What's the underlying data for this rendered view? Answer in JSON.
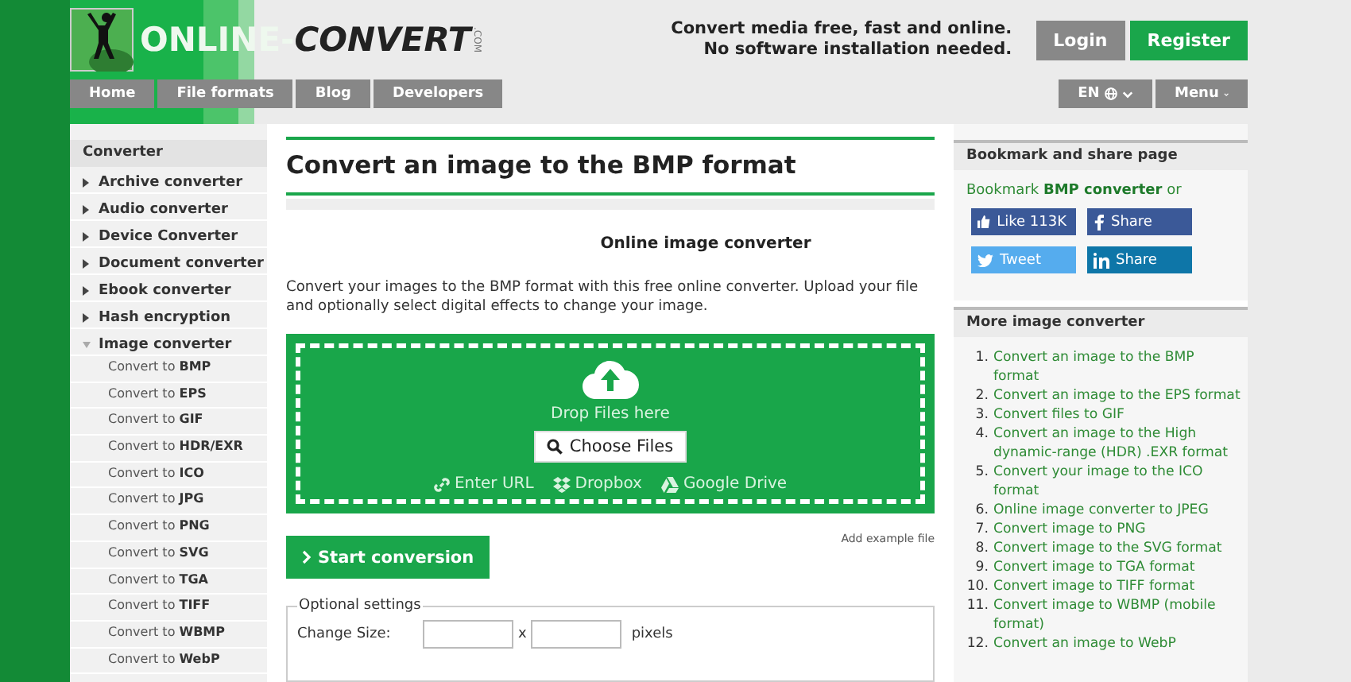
{
  "logo": {
    "part1": "ONLINE-",
    "part2": "CONVERT",
    "part3": ".COM"
  },
  "tagline": [
    "Convert media free, fast and online.",
    "No software installation needed."
  ],
  "account_buttons": [
    {
      "label": "Login",
      "kind": "secondary"
    },
    {
      "label": "Register",
      "kind": "primary"
    }
  ],
  "nav": [
    {
      "label": "Home"
    },
    {
      "label": "File formats"
    },
    {
      "label": "Blog"
    },
    {
      "label": "Developers"
    }
  ],
  "nav_right": [
    {
      "label": "EN",
      "kind": "language"
    },
    {
      "label": "Menu",
      "kind": "menu"
    }
  ],
  "sidebar": {
    "title": "Converter",
    "items": [
      {
        "label": "Archive converter",
        "expanded": false
      },
      {
        "label": "Audio converter",
        "expanded": false
      },
      {
        "label": "Device Converter",
        "expanded": false
      },
      {
        "label": "Document converter",
        "expanded": false
      },
      {
        "label": "Ebook converter",
        "expanded": false
      },
      {
        "label": "Hash encryption",
        "expanded": false
      },
      {
        "label": "Image converter",
        "expanded": true,
        "children": [
          {
            "label": "Convert to **BMP**"
          },
          {
            "label": "Convert to **EPS**"
          },
          {
            "label": "Convert to **GIF**"
          },
          {
            "label": "Convert to **HDR/EXR**"
          },
          {
            "label": "Convert to **ICO**"
          },
          {
            "label": "Convert to **JPG**"
          },
          {
            "label": "Convert to **PNG**"
          },
          {
            "label": "Convert to **SVG**"
          },
          {
            "label": "Convert to **TGA**"
          },
          {
            "label": "Convert to **TIFF**"
          },
          {
            "label": "Convert to **WBMP**"
          },
          {
            "label": "Convert to **WebP**"
          }
        ]
      }
    ]
  },
  "main": {
    "title": "Convert an image to the BMP format",
    "subtitle": "Online image converter",
    "description": "Convert your images to the BMP format with this free online converter. Upload your file and optionally select digital effects to change your image.",
    "dropzone": {
      "hint": "Drop Files here",
      "choose_button": "Choose Files",
      "sources": [
        {
          "label": "Enter URL",
          "kind": "url"
        },
        {
          "label": "Dropbox",
          "kind": "dropbox"
        },
        {
          "label": "Google Drive",
          "kind": "drive"
        }
      ]
    },
    "start_button": "Start conversion",
    "example_link": "Add example file",
    "optional_settings": {
      "legend": "Optional settings",
      "size_label": "Change Size:",
      "separator": "x",
      "unit": "pixels"
    }
  },
  "share": {
    "title": "Bookmark and share page",
    "text": "Bookmark **BMP converter** or",
    "buttons": [
      {
        "label": "Like 113K",
        "kind": "like"
      },
      {
        "label": "Share",
        "kind": "facebook"
      },
      {
        "label": "Tweet",
        "kind": "twitter"
      },
      {
        "label": "Share",
        "kind": "linkedin"
      }
    ]
  },
  "more": {
    "title": "More image converter",
    "links": [
      {
        "number": "1.",
        "label": "Convert an image to the BMP format"
      },
      {
        "number": "2.",
        "label": "Convert an image to the EPS format"
      },
      {
        "number": "3.",
        "label": "Convert files to GIF"
      },
      {
        "number": "4.",
        "label": "Convert an image to the High dynamic-range (HDR) .EXR format"
      },
      {
        "number": "5.",
        "label": "Convert your image to the ICO format"
      },
      {
        "number": "6.",
        "label": "Online image converter to JPEG"
      },
      {
        "number": "7.",
        "label": "Convert image to PNG"
      },
      {
        "number": "8.",
        "label": "Convert image to the SVG format"
      },
      {
        "number": "9.",
        "label": "Convert image to TGA format"
      },
      {
        "number": "10.",
        "label": "Convert image to TIFF format"
      },
      {
        "number": "11.",
        "label": "Convert image to WBMP (mobile format)"
      },
      {
        "number": "12.",
        "label": "Convert an image to WebP"
      }
    ]
  }
}
